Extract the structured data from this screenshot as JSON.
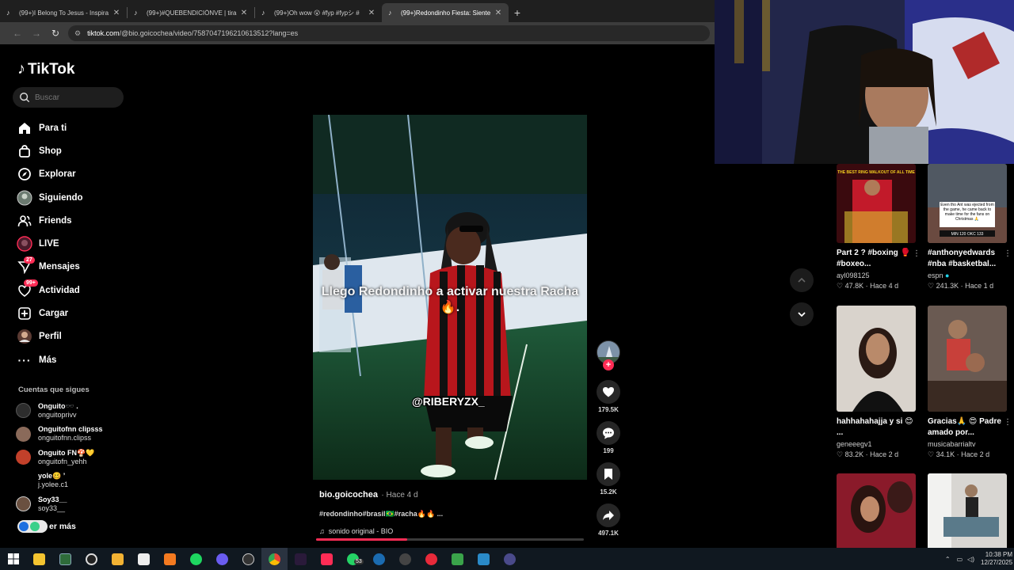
{
  "browser": {
    "tabs": [
      {
        "title": "(99+)I Belong To Jesus - Inspira"
      },
      {
        "title": "(99+)#QUEBENDICIÓNVE | tira"
      },
      {
        "title": "(99+)Oh wow 😮 #fyp #fypシ #"
      },
      {
        "title": "(99+)Redondinho Fiesta: Siente"
      }
    ],
    "url_host": "tiktok.com",
    "url_path": "/@bio.goicochea/video/7587047196210613512?lang=es"
  },
  "sidebar": {
    "brand": "TikTok",
    "search_placeholder": "Buscar",
    "nav": [
      {
        "label": "Para ti",
        "icon": "home-icon"
      },
      {
        "label": "Shop",
        "icon": "shop-bag-icon"
      },
      {
        "label": "Explorar",
        "icon": "compass-icon"
      },
      {
        "label": "Siguiendo",
        "icon": "following-avatar-icon"
      },
      {
        "label": "Friends",
        "icon": "friends-icon"
      },
      {
        "label": "LIVE",
        "icon": "live-icon"
      },
      {
        "label": "Mensajes",
        "icon": "inbox-icon",
        "badge": "27"
      },
      {
        "label": "Actividad",
        "icon": "activity-icon",
        "badge": "99+"
      },
      {
        "label": "Cargar",
        "icon": "upload-icon"
      },
      {
        "label": "Perfil",
        "icon": "profile-avatar-icon"
      },
      {
        "label": "Más",
        "icon": "more-dots-icon"
      }
    ],
    "following_title": "Cuentas que sigues",
    "following": [
      {
        "name": "Onguito🕶️ .",
        "handle": "onguitoprivv"
      },
      {
        "name": "Onguitofnn clipsss",
        "handle": "onguitofnn.clipss"
      },
      {
        "name": "Onguito FN🍄💛",
        "handle": "onguitofn_yehh"
      },
      {
        "name": "yole🥴 ’",
        "handle": "j.yolee.c1"
      },
      {
        "name": "Soy33__",
        "handle": "soy33__"
      }
    ],
    "more_label": "er más"
  },
  "video": {
    "caption": "Llego Redondinho a activar nuestra Racha 🔥.",
    "overlay_tag": "@RIBERYZX_",
    "author": "bio.goicochea",
    "age": "· Hace 4 d",
    "description": "#redondinho#brasil🇧🇷#racha🔥🔥 ...",
    "music": "sonido original - BIO",
    "progress": 0.34
  },
  "actions": {
    "likes": "179.5K",
    "comments": "199",
    "saves": "15.2K",
    "shares": "497.1K"
  },
  "recommendations": [
    {
      "title": "Part 2 ? #boxing 🥊 #boxeo...",
      "channel": "ayl098125",
      "views": "47.8K",
      "age": "· Hace 4 d"
    },
    {
      "title": "#anthonyedwards #nba #basketbal...",
      "channel": "espn",
      "views": "241.3K",
      "age": "· Hace 1 d"
    },
    {
      "title": "hahhahahajja y si 😊 ...",
      "channel": "geneeegv1",
      "views": "83.2K",
      "age": "· Hace 2 d"
    },
    {
      "title": "Gracias🙏 😍 Padre amado por...",
      "channel": "musicabarrialtv",
      "views": "34.1K",
      "age": "· Hace 2 d"
    },
    {
      "title": "",
      "channel": "",
      "views": "",
      "age": ""
    },
    {
      "title": "",
      "channel": "",
      "views": "",
      "age": ""
    }
  ],
  "thumb_texts": {
    "r0": "THE BEST RING WALKOUT OF ALL TIME",
    "r1": "Even tho Ant was ejected from the game, he came back to make time for the fans on Christmas 🙏",
    "r1_score": "MIN 120 OKC 133"
  },
  "taskbar": {
    "whatsapp_badge": "53",
    "time": "10:38 PM",
    "date": "12/27/2025",
    "apps": [
      "windows-start-icon",
      "file-explorer-icon",
      "terminal-icon",
      "obs-icon",
      "folder-icon",
      "epic-games-icon",
      "vlc-icon",
      "spotify-icon",
      "discord-icon",
      "steam-deck-icon",
      "chrome-icon",
      "kick-icon",
      "tiktok-app-icon",
      "whatsapp-icon",
      "steam-icon",
      "4k-downloader-icon",
      "recorder-icon",
      "minecraft-icon",
      "launcher-icon",
      "stream-deck-icon"
    ]
  },
  "colors": {
    "accent": "#fe2c55",
    "verified": "#20d5ec"
  }
}
